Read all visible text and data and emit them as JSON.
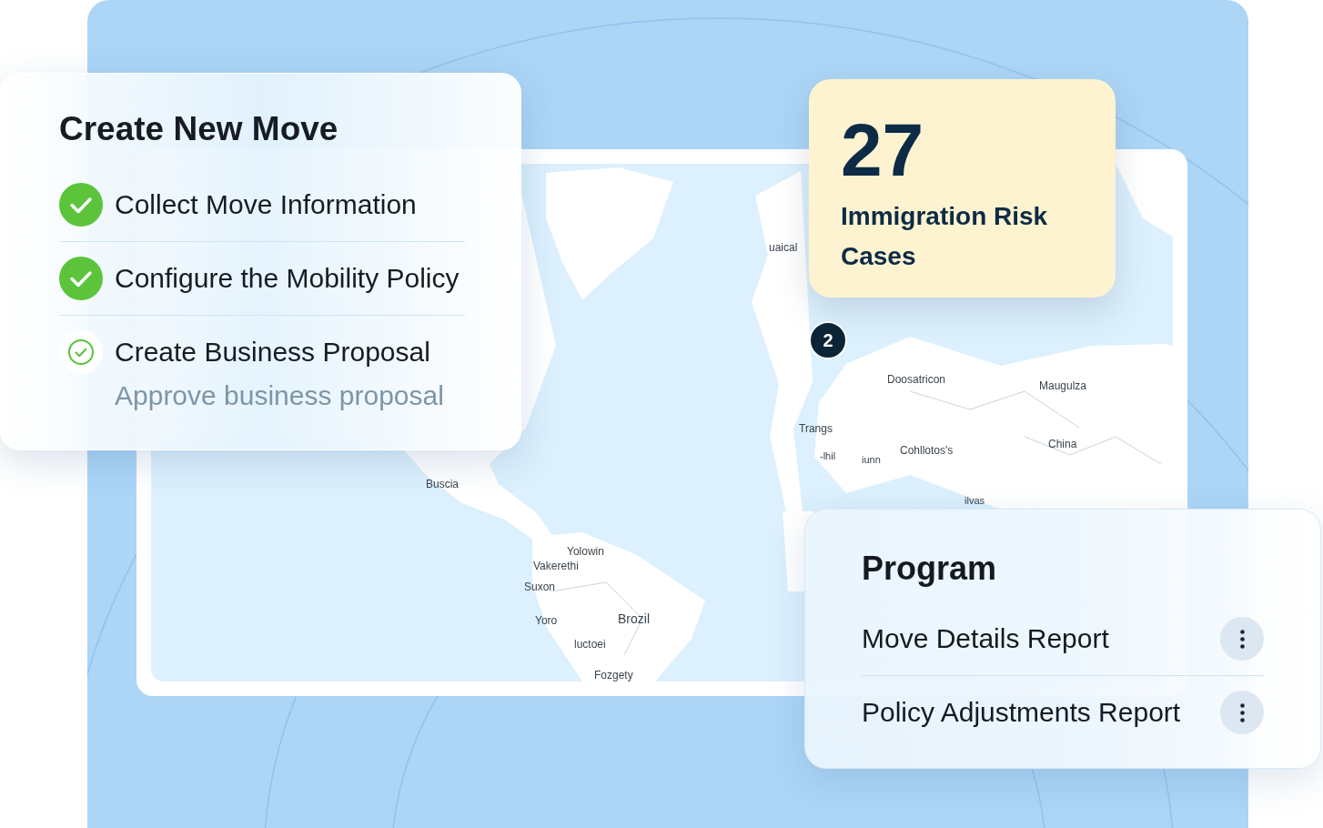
{
  "create_move_card": {
    "title": "Create New Move",
    "steps": [
      {
        "label": "Collect Move Information",
        "completed": true
      },
      {
        "label": "Configure the Mobility Policy",
        "completed": true
      },
      {
        "label": "Create Business Proposal",
        "completed": false,
        "subtitle": "Approve business proposal"
      }
    ]
  },
  "map": {
    "labels": [
      "uaical",
      "Doosatricon",
      "Maugulza",
      "Trangs",
      "-lhil",
      "iunn",
      "Cohllotos's",
      "China",
      "ilvas",
      "Buscia",
      "Yolowin",
      "Vakerethi",
      "Suxon",
      "Yoro",
      "Brozil",
      "luctoei",
      "Fozgety"
    ],
    "marker": {
      "count": "2"
    }
  },
  "risk_card": {
    "count": "27",
    "label": "Immigration Risk Cases"
  },
  "program_card": {
    "title": "Program",
    "reports": [
      {
        "label": "Move Details Report"
      },
      {
        "label": "Policy Adjustments Report"
      }
    ]
  }
}
